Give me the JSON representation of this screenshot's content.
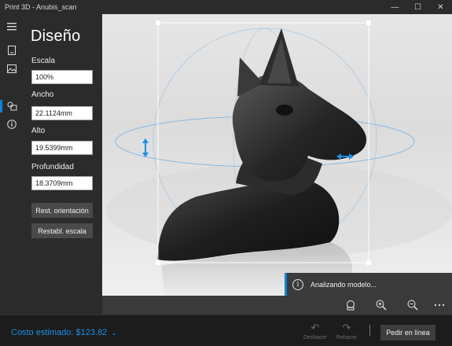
{
  "window": {
    "title": "Print 3D - Anubis_scan",
    "minimize": "—",
    "maximize": "☐",
    "close": "✕"
  },
  "panel": {
    "title": "Diseño",
    "scale_label": "Escala",
    "scale_value": "100%",
    "width_label": "Ancho",
    "width_value": "22.1124mm",
    "height_label": "Alto",
    "height_value": "19.5399mm",
    "depth_label": "Profundidad",
    "depth_value": "18.3709mm",
    "reset_orientation": "Rest. orientación",
    "reset_scale": "Restabl. escala"
  },
  "rail": {
    "items": [
      "menu-icon",
      "file-icon",
      "image-icon",
      "design-icon",
      "info-icon"
    ],
    "active": 3
  },
  "toast": {
    "text": "Analizando modelo..."
  },
  "bottom": {
    "cost": "Costo estimado: $123.82",
    "undo": "Deshacer",
    "redo": "Rehacer",
    "order": "Pedir en línea"
  },
  "colors": {
    "accent": "#0a84d6",
    "cost": "#1e90e8"
  }
}
